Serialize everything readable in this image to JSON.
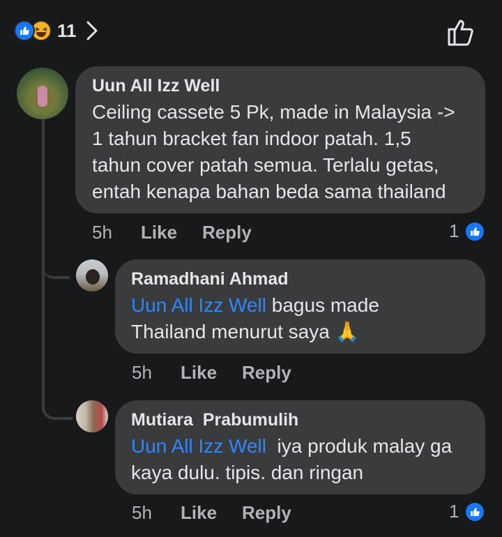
{
  "header": {
    "reaction_count": "11"
  },
  "comments": [
    {
      "author": "Uun All Izz Well",
      "lines": [
        "Ceiling cassete 5 Pk, made in Malaysia ->",
        "1 tahun bracket fan indoor patah. 1,5",
        "tahun cover patah semua. Terlalu getas,",
        "entah kenapa bahan beda sama thailand"
      ],
      "time": "5h",
      "like": "Like",
      "reply": "Reply",
      "reactions": "1"
    },
    {
      "author": "Ramadhani Ahmad",
      "mention": "Uun All Izz Well",
      "line1_rest": " bagus made",
      "line2": "Thailand menurut saya",
      "emoji": "🙏",
      "time": "5h",
      "like": "Like",
      "reply": "Reply"
    },
    {
      "author": "Mutiara  Prabumulih",
      "mention": "Uun All Izz Well",
      "line1_rest": "  iya produk malay ga",
      "line2": "kaya dulu. tipis. dan ringan",
      "time": "5h",
      "like": "Like",
      "reply": "Reply",
      "reactions": "1"
    }
  ]
}
